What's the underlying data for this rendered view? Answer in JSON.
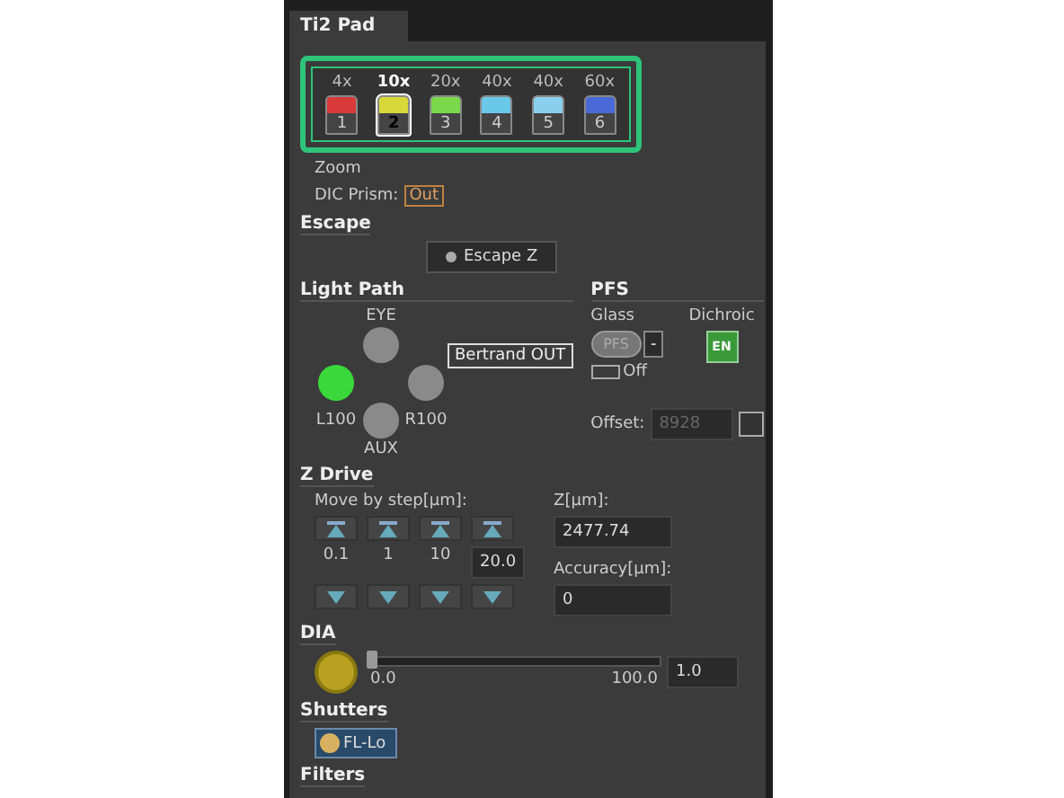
{
  "panel": {
    "title": "Ti2 Pad"
  },
  "objectives": [
    {
      "label": "4x",
      "number": "1",
      "color": "#d83a3a",
      "selected": false
    },
    {
      "label": "10x",
      "number": "2",
      "color": "#d8d83a",
      "selected": true
    },
    {
      "label": "20x",
      "number": "3",
      "color": "#7ad84a",
      "selected": false
    },
    {
      "label": "40x",
      "number": "4",
      "color": "#6ac8e8",
      "selected": false
    },
    {
      "label": "40x",
      "number": "5",
      "color": "#8ad0ee",
      "selected": false
    },
    {
      "label": "60x",
      "number": "6",
      "color": "#4a6ad8",
      "selected": false
    }
  ],
  "zoom": {
    "label": "Zoom"
  },
  "dic": {
    "label": "DIC Prism:",
    "value": "Out"
  },
  "escape": {
    "title": "Escape",
    "button": "Escape Z"
  },
  "light_path": {
    "title": "Light Path",
    "ports": [
      {
        "label": "EYE",
        "selected": false
      },
      {
        "label": "L100",
        "selected": true
      },
      {
        "label": "R100",
        "selected": false
      },
      {
        "label": "AUX",
        "selected": false
      }
    ],
    "bertrand": "Bertrand OUT"
  },
  "pfs": {
    "title": "PFS",
    "glass_label": "Glass",
    "pfs_button": "PFS",
    "caret": "-",
    "off_label": "Off",
    "dichroic_label": "Dichroic",
    "dichroic": "EN",
    "dichroic_on": true,
    "offset_label": "Offset:",
    "offset_value": "8928"
  },
  "z_drive": {
    "title": "Z Drive",
    "step_label": "Move by step[µm]:",
    "steps": [
      "0.1",
      "1",
      "10"
    ],
    "custom_step": "20.0",
    "z_label": "Z[µm]:",
    "z_value": "2477.74",
    "accuracy_label": "Accuracy[µm]:",
    "accuracy_value": "0"
  },
  "dia": {
    "title": "DIA",
    "level": 0,
    "min": "0.0",
    "max": "100.0",
    "value": "1.0"
  },
  "shutters": {
    "title": "Shutters",
    "button": "FL-Lo"
  },
  "filters": {
    "title": "Filters"
  }
}
